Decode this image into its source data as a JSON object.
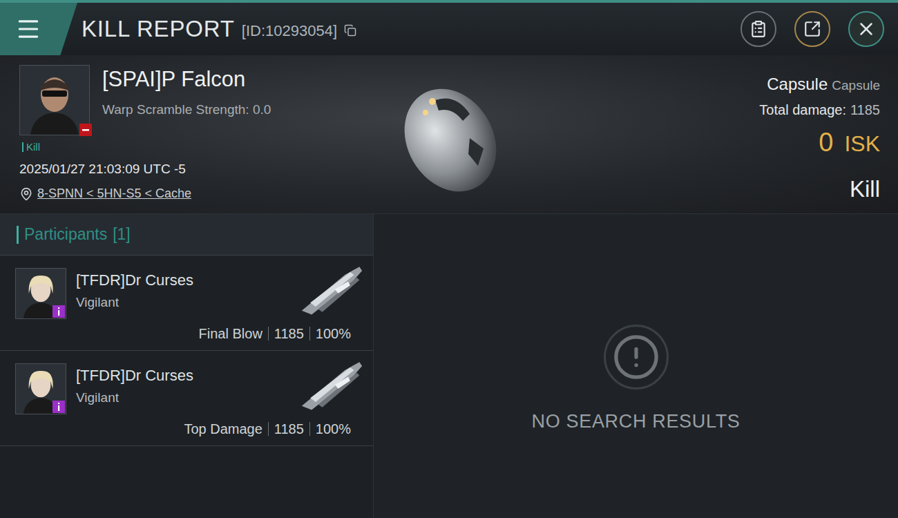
{
  "header": {
    "title": "KILL REPORT",
    "id": "[ID:10293054]"
  },
  "victim": {
    "name": "[SPAI]P Falcon",
    "warp_scramble": "Warp Scramble Strength: 0.0",
    "tag": "Kill",
    "time": "2025/01/27 21:03:09 UTC -5",
    "location": "8-SPNN < 5HN-S5 < Cache"
  },
  "ship": {
    "name": "Capsule",
    "type": "Capsule",
    "damage_label": "Total damage:",
    "damage": "1185",
    "value": "0",
    "currency": "ISK",
    "result": "Kill"
  },
  "participants": {
    "label": "Participants",
    "count": "[1]",
    "items": [
      {
        "name": "[TFDR]Dr Curses",
        "ship": "Vigilant",
        "role": "Final Blow",
        "damage": "1185",
        "share": "100%"
      },
      {
        "name": "[TFDR]Dr Curses",
        "ship": "Vigilant",
        "role": "Top Damage",
        "damage": "1185",
        "share": "100%"
      }
    ]
  },
  "results": {
    "empty": "NO SEARCH RESULTS"
  }
}
